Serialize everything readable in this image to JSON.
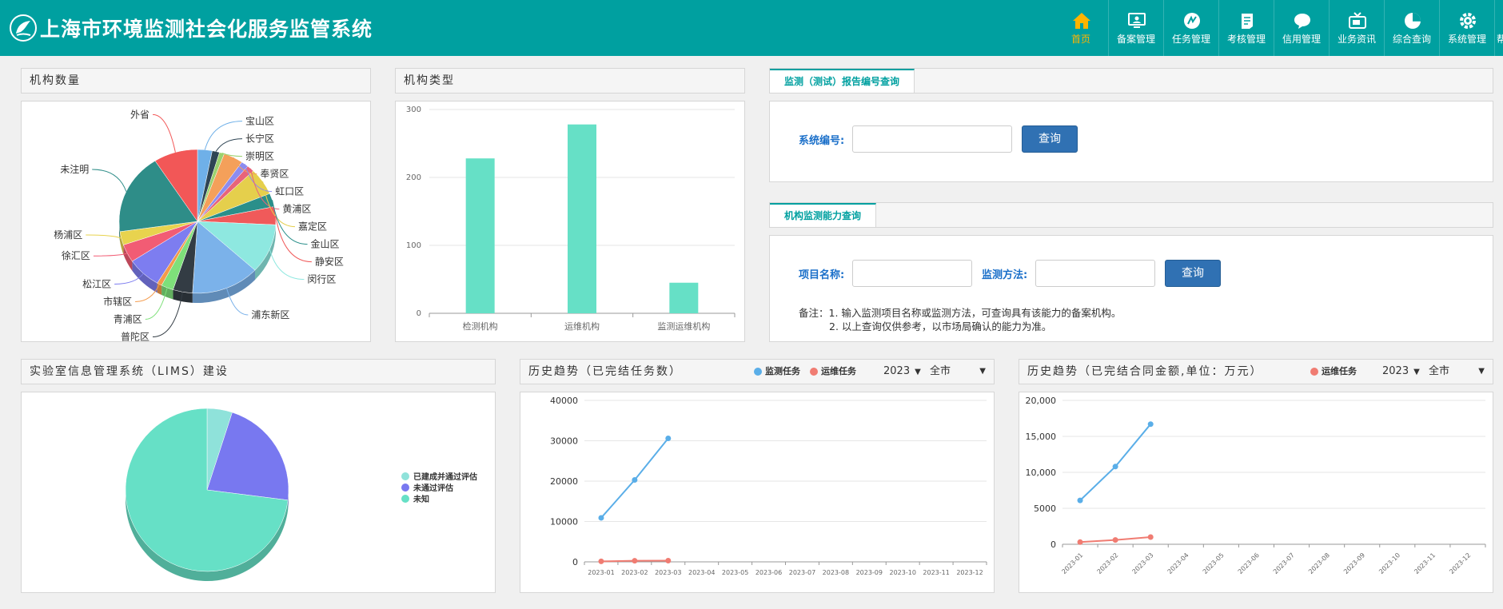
{
  "header": {
    "title": "上海市环境监测社会化服务监管系统",
    "nav": [
      {
        "label": "首页",
        "icon": "home-icon",
        "active": true
      },
      {
        "label": "备案管理",
        "icon": "monitor-icon"
      },
      {
        "label": "任务管理",
        "icon": "task-icon"
      },
      {
        "label": "考核管理",
        "icon": "assessment-icon"
      },
      {
        "label": "信用管理",
        "icon": "credit-icon"
      },
      {
        "label": "业务资讯",
        "icon": "news-tv-icon"
      },
      {
        "label": "综合查询",
        "icon": "pie-query-icon"
      },
      {
        "label": "系统管理",
        "icon": "gear-icon"
      },
      {
        "label": "帮助",
        "icon": "help-icon"
      }
    ]
  },
  "panels": {
    "org_count": {
      "title": "机构数量"
    },
    "org_type": {
      "title": "机构类型"
    },
    "report_query": {
      "tab": "监测（测试）报告编号查询",
      "field_label": "系统编号:",
      "field_value": "",
      "button": "查询"
    },
    "capability_query": {
      "tab": "机构监测能力查询",
      "item_label": "项目名称:",
      "method_label": "监测方法:",
      "item_value": "",
      "method_value": "",
      "button": "查询",
      "note_line1": "备注：1. 输入监测项目名称或监测方法，可查询具有该能力的备案机构。",
      "note_line2": "2. 以上查询仅供参考，以市场局确认的能力为准。"
    },
    "lims": {
      "title": "实验室信息管理系统（LIMS）建设"
    },
    "trend_tasks": {
      "title": "历史趋势（已完结任务数）",
      "year": "2023",
      "region": "全市"
    },
    "trend_amount": {
      "title": "历史趋势（已完结合同金额,单位：万元）",
      "year": "2023",
      "region": "全市"
    }
  },
  "colors": {
    "header": "#00a0a0",
    "accent_blue": "#3071b3",
    "bar": "#66e0c6",
    "series_monitor": "#5aaee8",
    "series_ops": "#f07c72"
  },
  "chart_data": [
    {
      "id": "org_count",
      "type": "pie",
      "title": "",
      "slices": [
        {
          "label": "宝山区",
          "value": 3,
          "color": "#6fb0e8"
        },
        {
          "label": "长宁区",
          "value": 1.5,
          "color": "#2f4554"
        },
        {
          "label": "崇明区",
          "value": 1,
          "color": "#9bd26e"
        },
        {
          "label": "奉贤区",
          "value": 4,
          "color": "#f4a05a"
        },
        {
          "label": "虹口区",
          "value": 1.5,
          "color": "#8c8cf0"
        },
        {
          "label": "黄浦区",
          "value": 1.5,
          "color": "#e8647a"
        },
        {
          "label": "嘉定区",
          "value": 6,
          "color": "#e5cf4c"
        },
        {
          "label": "金山区",
          "value": 3,
          "color": "#2a8f8a"
        },
        {
          "label": "静安区",
          "value": 4,
          "color": "#f05a5a"
        },
        {
          "label": "闵行区",
          "value": 11,
          "color": "#8ee8e0"
        },
        {
          "label": "浦东新区",
          "value": 14,
          "color": "#7bb2ea"
        },
        {
          "label": "普陀区",
          "value": 4,
          "color": "#333c44"
        },
        {
          "label": "青浦区",
          "value": 2.5,
          "color": "#7ee07a"
        },
        {
          "label": "市辖区",
          "value": 1,
          "color": "#f49a4a"
        },
        {
          "label": "松江区",
          "value": 7,
          "color": "#7d7df0"
        },
        {
          "label": "徐汇区",
          "value": 4,
          "color": "#f25c74"
        },
        {
          "label": "杨浦区",
          "value": 3,
          "color": "#e8d34e"
        },
        {
          "label": "未注明",
          "value": 18,
          "color": "#2e8d88"
        },
        {
          "label": "外省",
          "value": 9,
          "color": "#f25757"
        }
      ]
    },
    {
      "id": "org_type",
      "type": "bar",
      "categories": [
        "检测机构",
        "运维机构",
        "监测运维机构"
      ],
      "values": [
        228,
        278,
        45
      ],
      "ylim": [
        0,
        300
      ],
      "yticks": [
        0,
        100,
        200,
        300
      ],
      "grid": true
    },
    {
      "id": "lims",
      "type": "pie",
      "legend_position": "right",
      "slices": [
        {
          "label": "已建成并通过评估",
          "value": 5,
          "color": "#8fe2da"
        },
        {
          "label": "未通过评估",
          "value": 22,
          "color": "#7878f0"
        },
        {
          "label": "未知",
          "value": 73,
          "color": "#66e0c6"
        }
      ]
    },
    {
      "id": "trend_tasks",
      "type": "line",
      "x": [
        "2023-01",
        "2023-02",
        "2023-03",
        "2023-04",
        "2023-05",
        "2023-06",
        "2023-07",
        "2023-08",
        "2023-09",
        "2023-10",
        "2023-11",
        "2023-12"
      ],
      "ylim": [
        0,
        40000
      ],
      "yticks": [
        "0",
        "10000",
        "20000",
        "30000",
        "40000"
      ],
      "yticks_values": [
        0,
        10000,
        20000,
        30000,
        40000
      ],
      "series": [
        {
          "name": "监测任务",
          "values": [
            10900,
            20300,
            30600
          ],
          "color": "#5aaee8"
        },
        {
          "name": "运维任务",
          "values": [
            120,
            260,
            300
          ],
          "color": "#f07c72"
        }
      ],
      "legend_position": "top-right",
      "grid": true
    },
    {
      "id": "trend_amount",
      "type": "line",
      "x": [
        "2023-01",
        "2023-02",
        "2023-03",
        "2023-04",
        "2023-05",
        "2023-06",
        "2023-07",
        "2023-08",
        "2023-09",
        "2023-10",
        "2023-11",
        "2023-12"
      ],
      "ylim": [
        0,
        20000
      ],
      "yticks": [
        "0",
        "5000",
        "10,000",
        "15,000",
        "20,000"
      ],
      "yticks_values": [
        0,
        5000,
        10000,
        15000,
        20000
      ],
      "series": [
        {
          "name": "运维任务",
          "values": [
            300,
            600,
            1000
          ],
          "color": "#f07c72"
        },
        {
          "values": [
            6100,
            10800,
            16700
          ],
          "color": "#5aaee8"
        }
      ],
      "legend_position": "top-right",
      "grid": true
    }
  ]
}
